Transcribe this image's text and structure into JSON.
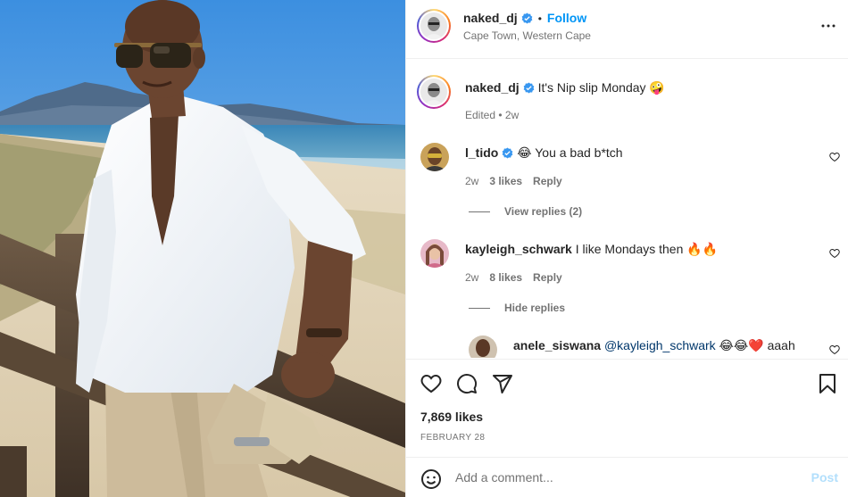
{
  "post": {
    "author": "naked_dj",
    "follow_label": "Follow",
    "dot": "•",
    "location": "Cape Town, Western Cape",
    "more_icon": "more-horizontal-icon"
  },
  "caption": {
    "username": "naked_dj",
    "text": "It's Nip slip Monday 🤪",
    "meta": "Edited • 2w"
  },
  "comments": [
    {
      "username": "l_tido",
      "verified": true,
      "text": "😂 You a bad b*tch",
      "time": "2w",
      "likes": "3 likes",
      "reply_label": "Reply",
      "replies_toggle": "View replies (2)"
    },
    {
      "username": "kayleigh_schwark",
      "verified": false,
      "text": "I like Mondays then 🔥🔥",
      "time": "2w",
      "likes": "8 likes",
      "reply_label": "Reply",
      "replies_toggle": "Hide replies"
    }
  ],
  "reply": {
    "username": "anele_siswana",
    "mention": "@kayleigh_schwark",
    "text": " 😂😂❤️ aaah"
  },
  "actions": {
    "likes": "7,869 likes",
    "date": "FEBRUARY 28"
  },
  "composer": {
    "placeholder": "Add a comment...",
    "post_label": "Post",
    "emoji_icon": "smiley-icon"
  },
  "colors": {
    "accent": "#0095f6",
    "verified": "#3897f0",
    "post_disabled": "#b2dffc",
    "muted": "#737373"
  }
}
